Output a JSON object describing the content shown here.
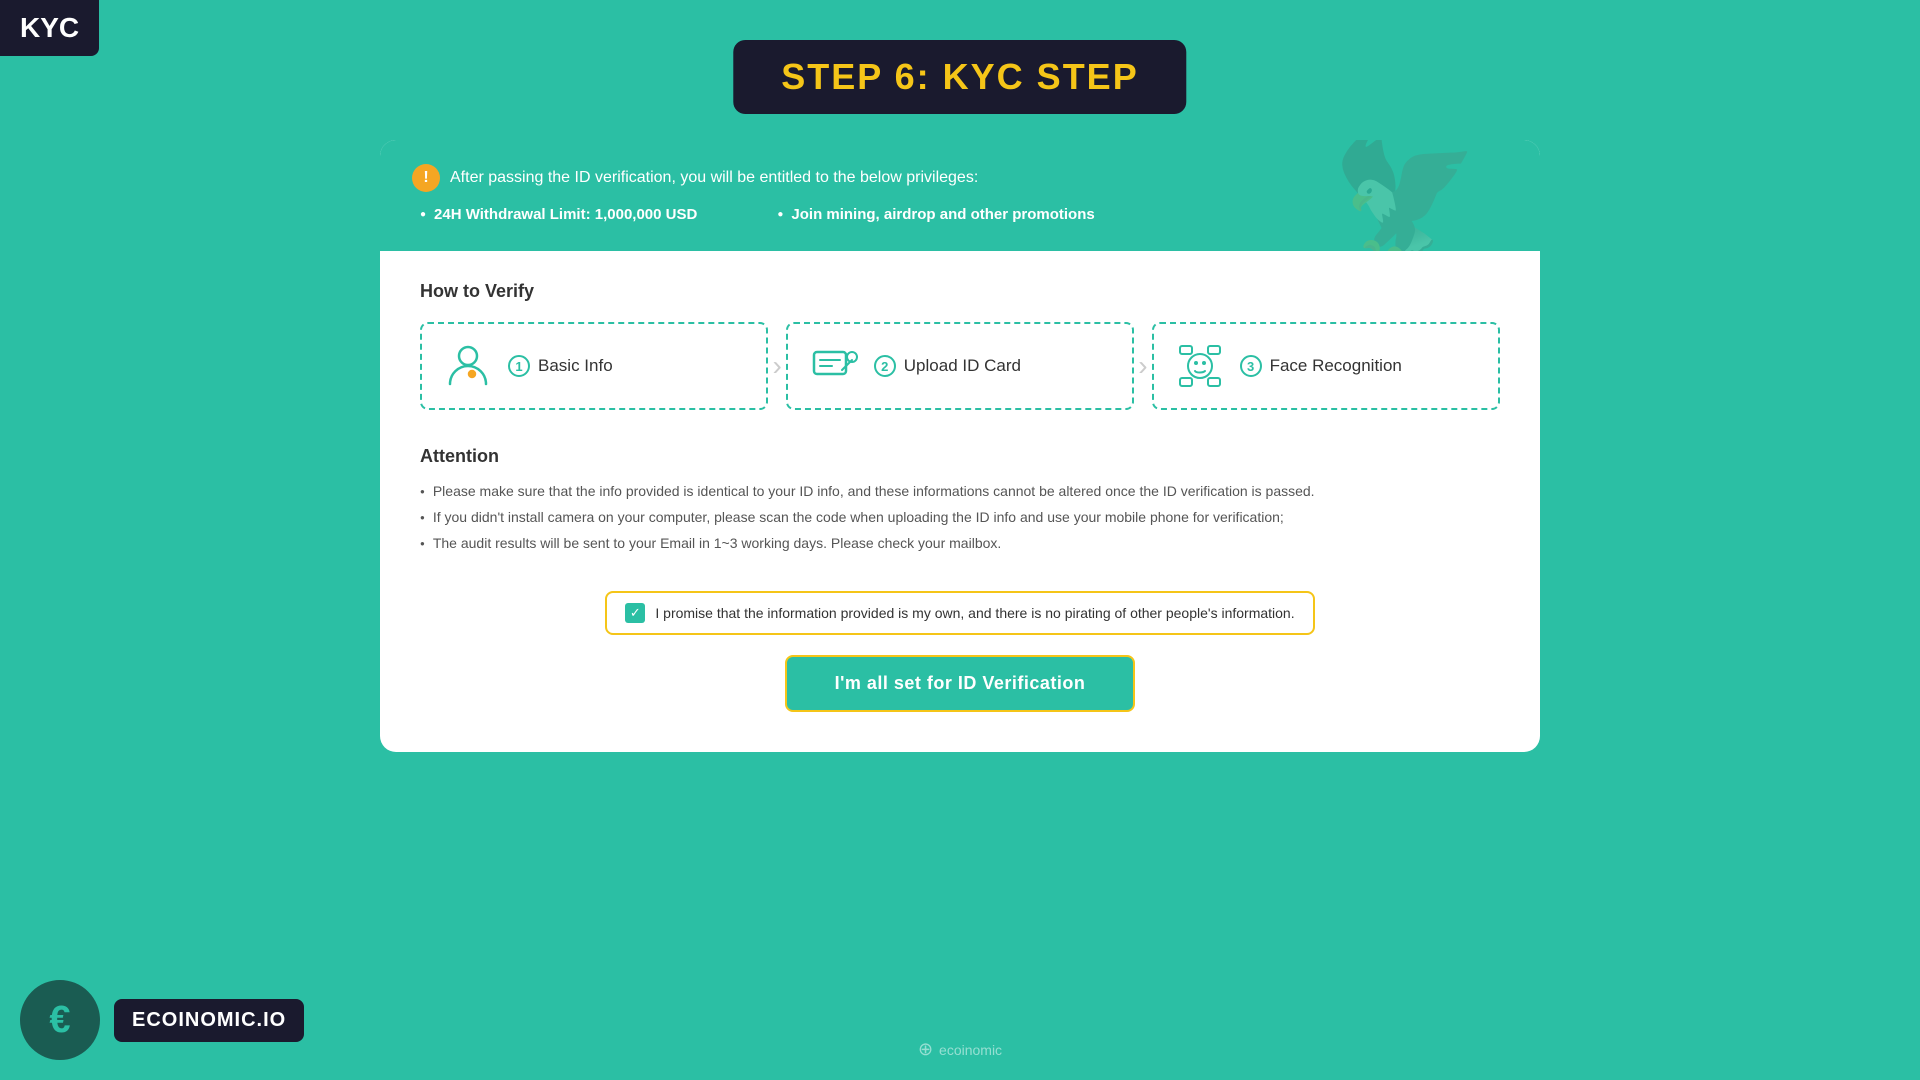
{
  "kyc_badge": "KYC",
  "step_title": "STEP 6: KYC STEP",
  "banner": {
    "header_text": "After passing the ID verification, you will be entitled to the below privileges:",
    "points": [
      "24H Withdrawal Limit: 1,000,000 USD",
      "Join mining, airdrop and other promotions"
    ]
  },
  "how_to_verify": {
    "title": "How to Verify",
    "steps": [
      {
        "number": "1",
        "label": "Basic Info"
      },
      {
        "number": "2",
        "label": "Upload ID Card"
      },
      {
        "number": "3",
        "label": "Face Recognition"
      }
    ]
  },
  "attention": {
    "title": "Attention",
    "items": [
      "Please make sure that the info provided is identical to your ID info, and these informations cannot be altered once the ID verification is passed.",
      "If you didn't install camera on your computer, please scan the code when uploading the ID info and use your mobile phone for verification;",
      "The audit results will be sent to your Email in 1~3 working days. Please check your mailbox."
    ]
  },
  "promise": {
    "checkbox_checked": true,
    "text": "I promise that the information provided is my own, and there is no pirating of other people's information."
  },
  "verify_button": "I'm all set for ID Verification",
  "logo": {
    "symbol": "€",
    "name": "ECOINOMIC.IO"
  },
  "watermark": "ecoinomic"
}
